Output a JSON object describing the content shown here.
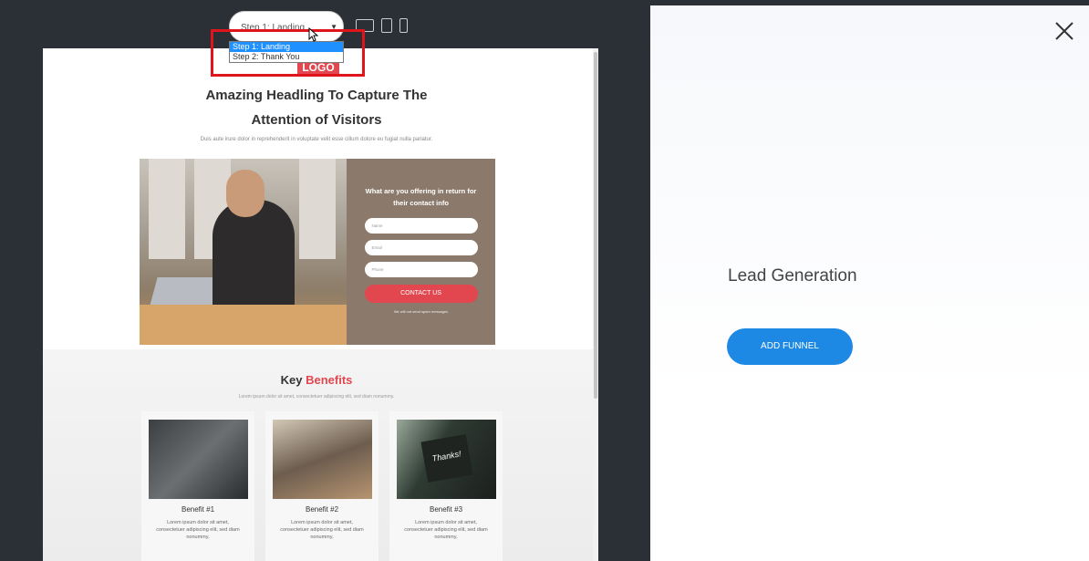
{
  "toolbar": {
    "step_select_value": "Step 1: Landing",
    "step_options": [
      "Step 1: Landing",
      "Step 2: Thank You"
    ],
    "device_icons": [
      "desktop-icon",
      "tablet-icon",
      "phone-icon"
    ]
  },
  "preview": {
    "logo": "LOGO",
    "headline_line1": "Amazing Headling To Capture The",
    "headline_line2": "Attention of Visitors",
    "subtext": "Duis aute irure dolor in reprehenderit in voluptate velit esse cillum dolore eu fugiat nulla pariatur.",
    "form": {
      "question_line1": "What are you offering in return for",
      "question_line2": "their contact info",
      "name_placeholder": "Name",
      "email_placeholder": "Email",
      "phone_placeholder": "Phone",
      "button": "CONTACT US",
      "spam_note": "We will not send spam messages"
    },
    "benefits": {
      "title_main": "Key",
      "title_accent": "Benefits",
      "subtitle": "Lorem ipsum dolor sit amet, consectetuer adipiscing elit, sed diam nonummy.",
      "cards": [
        {
          "title": "Benefit #1",
          "desc": "Lorem ipsum dolor sit amet, consectetuer adipiscing elit, sed diam nonummy."
        },
        {
          "title": "Benefit #2",
          "desc": "Lorem ipsum dolor sit amet, consectetuer adipiscing elit, sed diam nonummy."
        },
        {
          "title": "Benefit #3",
          "desc": "Lorem ipsum dolor sit amet, consectetuer adipiscing elit, sed diam nonummy."
        }
      ],
      "card3_note": "Thanks!"
    }
  },
  "panel": {
    "funnel_name": "Lead Generation",
    "add_button": "ADD FUNNEL"
  },
  "colors": {
    "accent_red": "#e2474f",
    "primary_blue": "#1e88e5",
    "highlight_red": "#e0141b"
  }
}
